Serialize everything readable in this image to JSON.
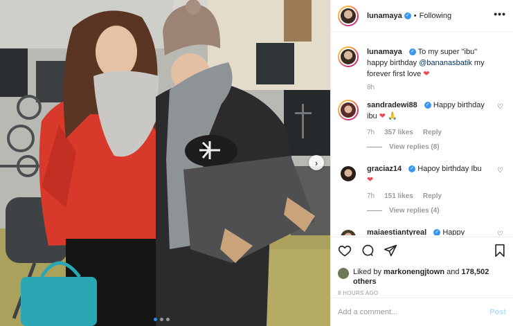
{
  "post": {
    "username": "lunamaya",
    "follow_status": "Following",
    "more_icon": "more-horizontal-icon",
    "separator": "•",
    "caption": {
      "text_1": "To my super \"ibu\" happy birthday",
      "mention": "@bananasbatik",
      "text_2": "my forever first love",
      "time": "8h"
    }
  },
  "comments": [
    {
      "username": "sandradewi88",
      "text": "Happy birthday ibu",
      "time": "7h",
      "likes": "357 likes",
      "reply_label": "Reply",
      "view_replies": "View replies (8)"
    },
    {
      "username": "graciaz14",
      "text": "Hapoy birthday Ibu",
      "time": "7h",
      "likes": "151 likes",
      "reply_label": "Reply",
      "view_replies": "View replies (4)"
    },
    {
      "username": "maiaestiantyreal",
      "text": "Happy"
    }
  ],
  "likes": {
    "prefix": "Liked by",
    "user": "markonengjtown",
    "and": "and",
    "count": "178,502 others"
  },
  "timestamp": "8 HOURS AGO",
  "add_comment": {
    "placeholder": "Add a comment...",
    "post_label": "Post"
  },
  "icons": {
    "like": "heart-icon",
    "comment": "comment-icon",
    "share": "share-icon",
    "save": "bookmark-icon",
    "next": "chevron-right-icon"
  },
  "colors": {
    "verified": "#3897f0",
    "heart": "#ed4956",
    "mention": "#003569",
    "post_disabled": "#b2dffc"
  }
}
